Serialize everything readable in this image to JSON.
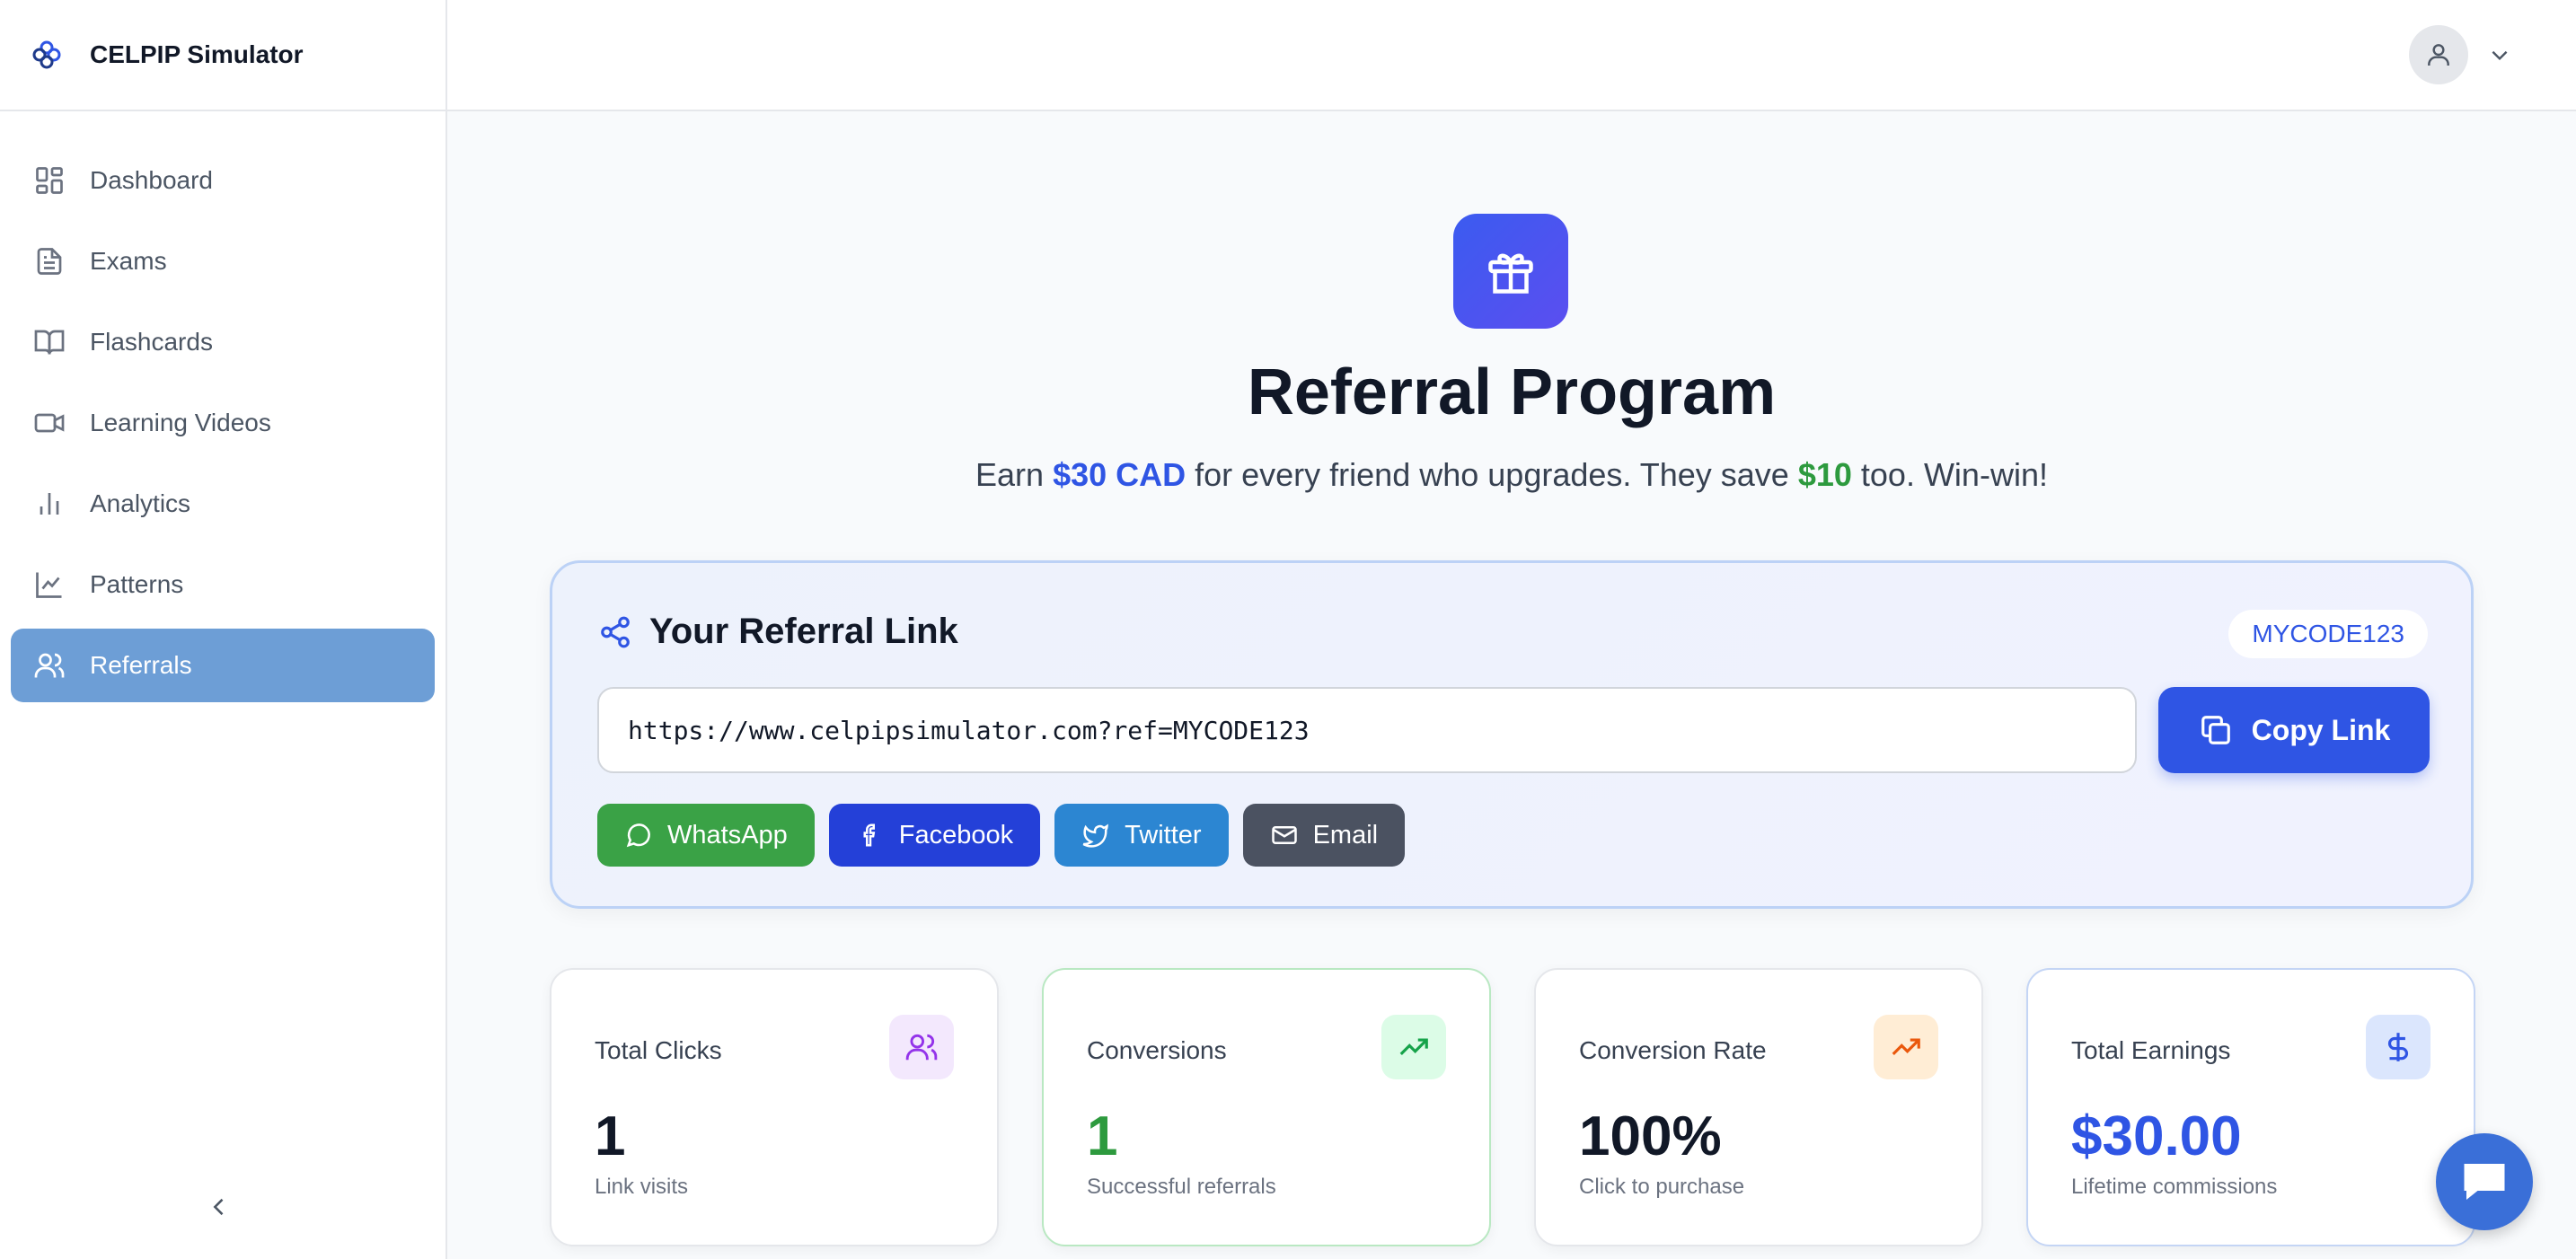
{
  "brand": {
    "name": "CELPIP Simulator",
    "logo_icon": "logo-icon"
  },
  "sidebar": {
    "items": [
      {
        "label": "Dashboard",
        "icon": "dashboard-icon",
        "active": false
      },
      {
        "label": "Exams",
        "icon": "document-icon",
        "active": false
      },
      {
        "label": "Flashcards",
        "icon": "book-icon",
        "active": false
      },
      {
        "label": "Learning Videos",
        "icon": "video-icon",
        "active": false
      },
      {
        "label": "Analytics",
        "icon": "bar-chart-icon",
        "active": false
      },
      {
        "label": "Patterns",
        "icon": "line-chart-icon",
        "active": false
      },
      {
        "label": "Referrals",
        "icon": "users-icon",
        "active": true
      }
    ],
    "active_color": "#6d9ed6"
  },
  "header": {
    "avatar_icon": "user-icon",
    "menu_icon": "chevron-down-icon"
  },
  "hero": {
    "title": "Referral Program",
    "subtitle_pre": "Earn ",
    "subtitle_amount": "$30 CAD",
    "subtitle_mid": " for every friend who upgrades. They save ",
    "subtitle_save": "$10",
    "subtitle_post": " too. Win-win!",
    "icon": "gift-icon"
  },
  "referral": {
    "title": "Your Referral Link",
    "code": "MYCODE123",
    "link": "https://www.celpipsimulator.com?ref=MYCODE123",
    "copy_label": "Copy Link",
    "share": [
      {
        "label": "WhatsApp",
        "icon": "whatsapp-icon",
        "color": "#3aa246"
      },
      {
        "label": "Facebook",
        "icon": "facebook-icon",
        "color": "#2440d8"
      },
      {
        "label": "Twitter",
        "icon": "twitter-icon",
        "color": "#2c86d2"
      },
      {
        "label": "Email",
        "icon": "mail-icon",
        "color": "#4b5261"
      }
    ]
  },
  "stats": [
    {
      "label": "Total Clicks",
      "value": "1",
      "sub": "Link visits",
      "icon": "users-icon",
      "value_color": "#111827",
      "icon_bg": "#f3e8fd",
      "icon_color": "#9333ea"
    },
    {
      "label": "Conversions",
      "value": "1",
      "sub": "Successful referrals",
      "icon": "trending-up-icon",
      "value_color": "#2d9a3e",
      "icon_bg": "#dcfce7",
      "icon_color": "#16a34a"
    },
    {
      "label": "Conversion Rate",
      "value": "100%",
      "sub": "Click to purchase",
      "icon": "trending-up-icon",
      "value_color": "#111827",
      "icon_bg": "#ffedd5",
      "icon_color": "#ea580c"
    },
    {
      "label": "Total Earnings",
      "value": "$30.00",
      "sub": "Lifetime commissions",
      "icon": "dollar-icon",
      "value_color": "#2f55e4",
      "icon_bg": "#dbe6fd",
      "icon_color": "#2f55e4"
    }
  ],
  "chat": {
    "icon": "chat-icon"
  }
}
